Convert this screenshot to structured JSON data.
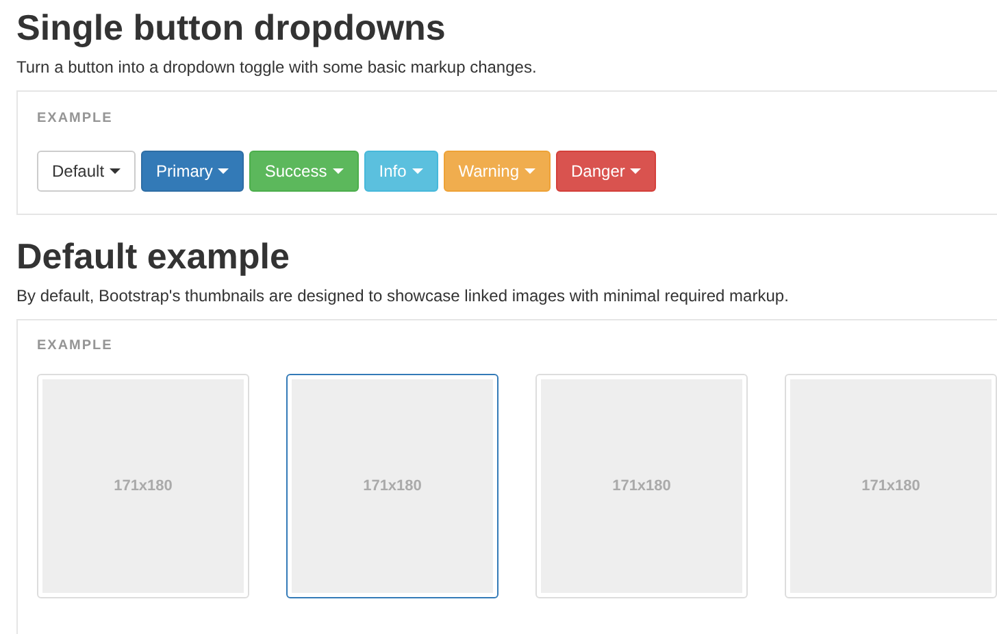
{
  "sections": [
    {
      "title": "Single button dropdowns",
      "description": "Turn a button into a dropdown toggle with some basic markup changes.",
      "example_label": "EXAMPLE",
      "kind": "buttons",
      "buttons": [
        {
          "label": "Default",
          "kind": "default"
        },
        {
          "label": "Primary",
          "kind": "primary"
        },
        {
          "label": "Success",
          "kind": "success"
        },
        {
          "label": "Info",
          "kind": "info"
        },
        {
          "label": "Warning",
          "kind": "warning"
        },
        {
          "label": "Danger",
          "kind": "danger"
        }
      ]
    },
    {
      "title": "Default example",
      "description": "By default, Bootstrap's thumbnails are designed to showcase linked images with minimal required markup.",
      "example_label": "EXAMPLE",
      "kind": "thumbnails",
      "thumbnails": [
        {
          "caption": "171x180",
          "selected": false
        },
        {
          "caption": "171x180",
          "selected": true
        },
        {
          "caption": "171x180",
          "selected": false
        },
        {
          "caption": "171x180",
          "selected": false
        }
      ]
    }
  ]
}
